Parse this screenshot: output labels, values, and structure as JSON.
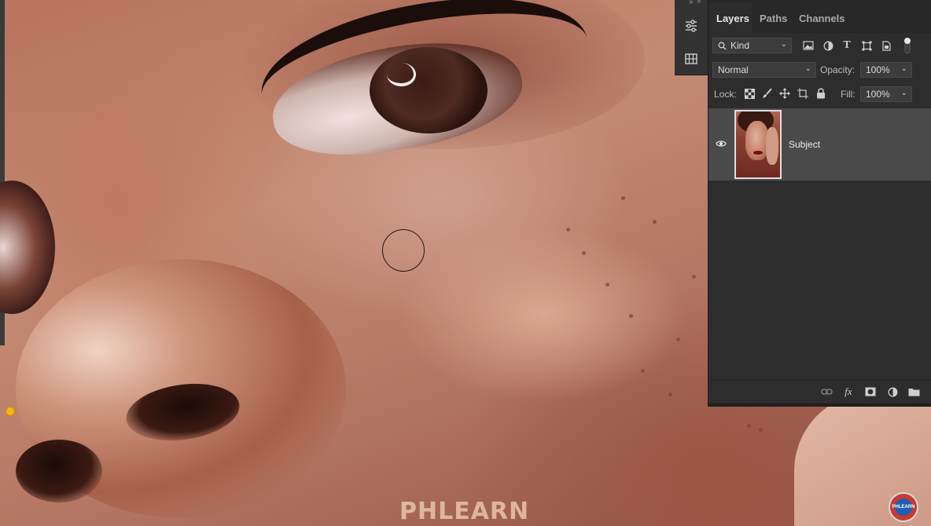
{
  "panel": {
    "tabs": [
      {
        "label": "Layers",
        "active": true
      },
      {
        "label": "Paths",
        "active": false
      },
      {
        "label": "Channels",
        "active": false
      }
    ],
    "filter": {
      "label": "Kind"
    },
    "blend_mode": {
      "value": "Normal"
    },
    "opacity": {
      "label": "Opacity:",
      "value": "100%"
    },
    "lock": {
      "label": "Lock:"
    },
    "fill": {
      "label": "Fill:",
      "value": "100%"
    },
    "layers": [
      {
        "name": "Subject",
        "visible": true,
        "selected": true
      }
    ]
  },
  "canvas": {
    "watermark_text": "PHLEARN",
    "logo_text": "PHLEARN"
  },
  "colors": {
    "panel_bg": "#2d2d2d",
    "tab_bar_bg": "#282828",
    "selected_layer_bg": "#4a4a4a",
    "accent_dot": "#f5b417"
  }
}
